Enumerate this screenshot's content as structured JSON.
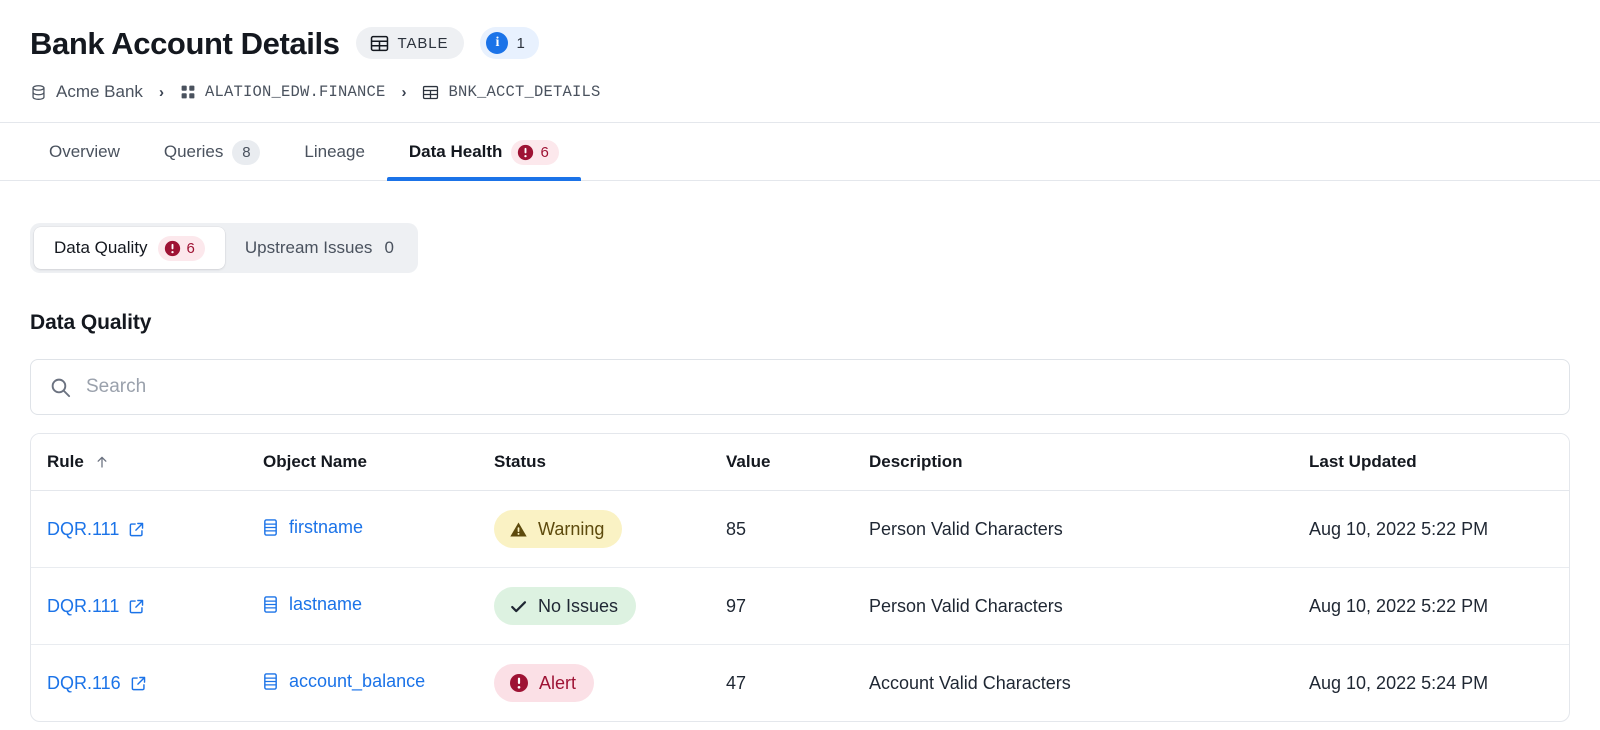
{
  "header": {
    "title": "Bank Account Details",
    "type_chip": {
      "label": "TABLE",
      "icon": "table-icon"
    },
    "info_chip": {
      "count": "1",
      "icon": "info-icon"
    },
    "breadcrumb": [
      {
        "label": "Acme Bank",
        "icon": "database-icon",
        "mono": false
      },
      {
        "label": "ALATION_EDW.FINANCE",
        "icon": "schema-grid-icon",
        "mono": true
      },
      {
        "label": "BNK_ACCT_DETAILS",
        "icon": "table-icon",
        "mono": true
      }
    ],
    "separator": "›"
  },
  "tabs": [
    {
      "label": "Overview",
      "badge": null,
      "active": false
    },
    {
      "label": "Queries",
      "badge": "8",
      "badge_type": "neutral",
      "active": false
    },
    {
      "label": "Lineage",
      "badge": null,
      "active": false
    },
    {
      "label": "Data Health",
      "badge": "6",
      "badge_type": "danger",
      "active": true
    }
  ],
  "segmented": {
    "items": [
      {
        "label": "Data Quality",
        "count": "6",
        "type": "danger",
        "active": true
      },
      {
        "label": "Upstream Issues",
        "count": "0",
        "type": "plain",
        "active": false
      }
    ]
  },
  "section": {
    "title": "Data Quality"
  },
  "search": {
    "value": "",
    "placeholder": "Search",
    "icon": "search-icon"
  },
  "table": {
    "columns": [
      {
        "key": "rule",
        "label": "Rule",
        "sort": "asc",
        "sort_icon": "arrow-up-icon"
      },
      {
        "key": "object_name",
        "label": "Object Name"
      },
      {
        "key": "status",
        "label": "Status"
      },
      {
        "key": "value",
        "label": "Value"
      },
      {
        "key": "description",
        "label": "Description"
      },
      {
        "key": "last_updated",
        "label": "Last Updated"
      }
    ],
    "rows": [
      {
        "rule": "DQR.111",
        "rule_icon": "external-link-icon",
        "object_name": "firstname",
        "object_icon": "column-icon",
        "status": "Warning",
        "status_type": "warning",
        "status_icon": "warning-triangle-icon",
        "value": "85",
        "description": "Person Valid Characters",
        "last_updated": "Aug 10, 2022 5:22 PM"
      },
      {
        "rule": "DQR.111",
        "rule_icon": "external-link-icon",
        "object_name": "lastname",
        "object_icon": "column-icon",
        "status": "No Issues",
        "status_type": "ok",
        "status_icon": "check-icon",
        "value": "97",
        "description": "Person Valid Characters",
        "last_updated": "Aug 10, 2022 5:22 PM"
      },
      {
        "rule": "DQR.116",
        "rule_icon": "external-link-icon",
        "object_name": "account_balance",
        "object_icon": "column-icon",
        "status": "Alert",
        "status_type": "alert",
        "status_icon": "alert-circle-icon",
        "value": "47",
        "description": "Account Valid Characters",
        "last_updated": "Aug 10, 2022 5:24 PM"
      }
    ]
  },
  "colors": {
    "accent": "#1b73e8",
    "danger": "#9e1334",
    "danger_bg": "#fce8ec",
    "warning_bg": "#faf2c4",
    "warning_fg": "#5d4a0c",
    "ok_bg": "#ddf2e1",
    "text": "#14181f",
    "muted": "#4a525e",
    "border": "#e4e7ec"
  }
}
